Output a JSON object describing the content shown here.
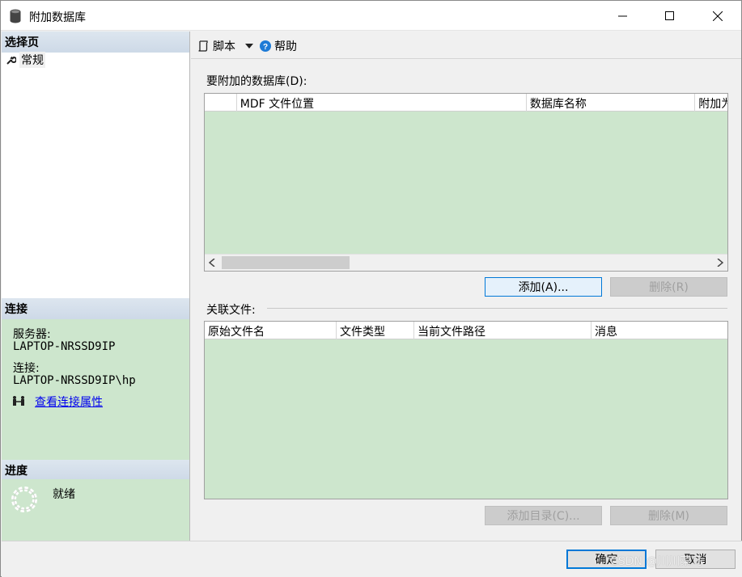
{
  "window": {
    "title": "附加数据库"
  },
  "left": {
    "select_page_header": "选择页",
    "nav_items": [
      {
        "label": "常规",
        "icon": "wrench-icon"
      }
    ],
    "connection_header": "连接",
    "server_label": "服务器:",
    "server_value": "LAPTOP-NRSSD9IP",
    "connection_label": "连接:",
    "connection_value": "LAPTOP-NRSSD9IP\\hp",
    "view_props_link": "查看连接属性",
    "progress_header": "进度",
    "progress_status": "就绪"
  },
  "toolbar": {
    "script_label": "脚本",
    "help_label": "帮助"
  },
  "attach": {
    "label": "要附加的数据库(D):",
    "columns": [
      "",
      "MDF 文件位置",
      "数据库名称",
      "附加为"
    ],
    "rows": [],
    "add_button": "添加(A)...",
    "remove_button": "删除(R)"
  },
  "related": {
    "label": "关联文件:",
    "columns": [
      "原始文件名",
      "文件类型",
      "当前文件路径",
      "消息"
    ],
    "rows": [],
    "add_catalog_button": "添加目录(C)...",
    "remove_button": "删除(M)"
  },
  "footer": {
    "ok_button": "确定",
    "cancel_button": "取消",
    "watermark": "CSDN @川川菜鸟"
  },
  "colors": {
    "grid_bg": "#cde6cd",
    "accent": "#0078d7",
    "header_grad": "#cdd9e7"
  }
}
